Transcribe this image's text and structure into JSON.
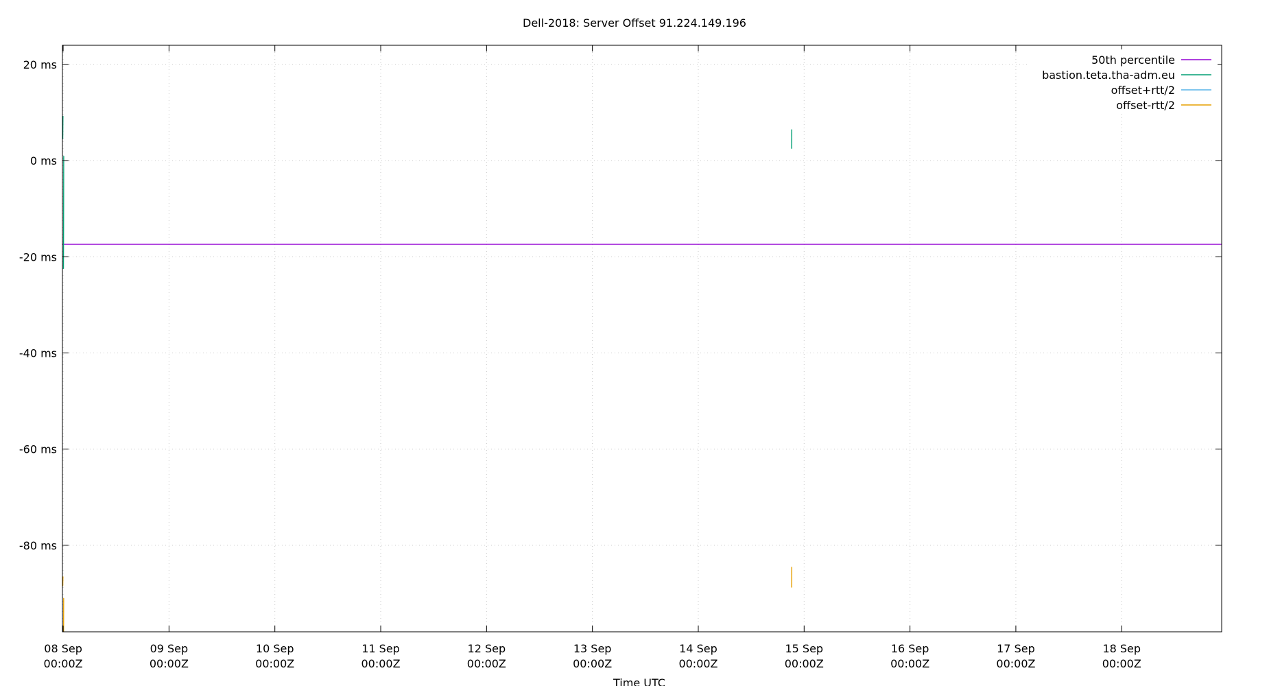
{
  "chart_data": {
    "type": "line",
    "title": "Dell-2018: Server Offset 91.224.149.196",
    "xlabel": "Time UTC",
    "ylabel": "",
    "y_unit": "ms",
    "ylim": [
      -98,
      24
    ],
    "xlim": [
      "2025-09-07T23:50:00Z",
      "2025-09-18T22:40:00Z"
    ],
    "x_ticks": [
      {
        "line1": "08 Sep",
        "line2": "00:00Z",
        "t": "2025-09-08T00:00:00Z"
      },
      {
        "line1": "09 Sep",
        "line2": "00:00Z",
        "t": "2025-09-09T00:00:00Z"
      },
      {
        "line1": "10 Sep",
        "line2": "00:00Z",
        "t": "2025-09-10T00:00:00Z"
      },
      {
        "line1": "11 Sep",
        "line2": "00:00Z",
        "t": "2025-09-11T00:00:00Z"
      },
      {
        "line1": "12 Sep",
        "line2": "00:00Z",
        "t": "2025-09-12T00:00:00Z"
      },
      {
        "line1": "13 Sep",
        "line2": "00:00Z",
        "t": "2025-09-13T00:00:00Z"
      },
      {
        "line1": "14 Sep",
        "line2": "00:00Z",
        "t": "2025-09-14T00:00:00Z"
      },
      {
        "line1": "15 Sep",
        "line2": "00:00Z",
        "t": "2025-09-15T00:00:00Z"
      },
      {
        "line1": "16 Sep",
        "line2": "00:00Z",
        "t": "2025-09-16T00:00:00Z"
      },
      {
        "line1": "17 Sep",
        "line2": "00:00Z",
        "t": "2025-09-17T00:00:00Z"
      },
      {
        "line1": "18 Sep",
        "line2": "00:00Z",
        "t": "2025-09-18T00:00:00Z"
      }
    ],
    "y_ticks": [
      {
        "value": 20,
        "label": "20 ms"
      },
      {
        "value": 0,
        "label": "0 ms"
      },
      {
        "value": -20,
        "label": "-20 ms"
      },
      {
        "value": -40,
        "label": "-40 ms"
      },
      {
        "value": -60,
        "label": "-60 ms"
      },
      {
        "value": -80,
        "label": "-80 ms"
      }
    ],
    "grid": true,
    "legend_position": "top-right",
    "series": [
      {
        "name": "50th percentile",
        "color": "#9400d3",
        "kind": "hline",
        "value": -17.4
      },
      {
        "name": "bastion.teta.tha-adm.eu",
        "color": "#009e73",
        "segments": [
          [
            [
              "2025-09-07T23:55:00Z",
              4.5
            ],
            [
              "2025-09-07T23:57:00Z",
              9.3
            ]
          ],
          [
            [
              "2025-09-08T00:04:00Z",
              -22.5
            ],
            [
              "2025-09-08T00:06:00Z",
              -14
            ],
            [
              "2025-09-08T00:08:00Z",
              1
            ]
          ],
          [
            [
              "2025-09-14T21:10:00Z",
              2.5
            ],
            [
              "2025-09-14T21:11:00Z",
              6.5
            ]
          ]
        ]
      },
      {
        "name": "offset+rtt/2",
        "color": "#56b4e9",
        "segments": []
      },
      {
        "name": "offset-rtt/2",
        "color": "#e69f00",
        "segments": [
          [
            [
              "2025-09-07T23:55:00Z",
              -88.5
            ],
            [
              "2025-09-07T23:57:00Z",
              -86.5
            ]
          ],
          [
            [
              "2025-09-08T00:06:00Z",
              -98
            ],
            [
              "2025-09-08T00:07:00Z",
              -91
            ]
          ],
          [
            [
              "2025-09-14T21:10:00Z",
              -88.8
            ],
            [
              "2025-09-14T21:11:00Z",
              -84.5
            ]
          ]
        ]
      }
    ]
  }
}
